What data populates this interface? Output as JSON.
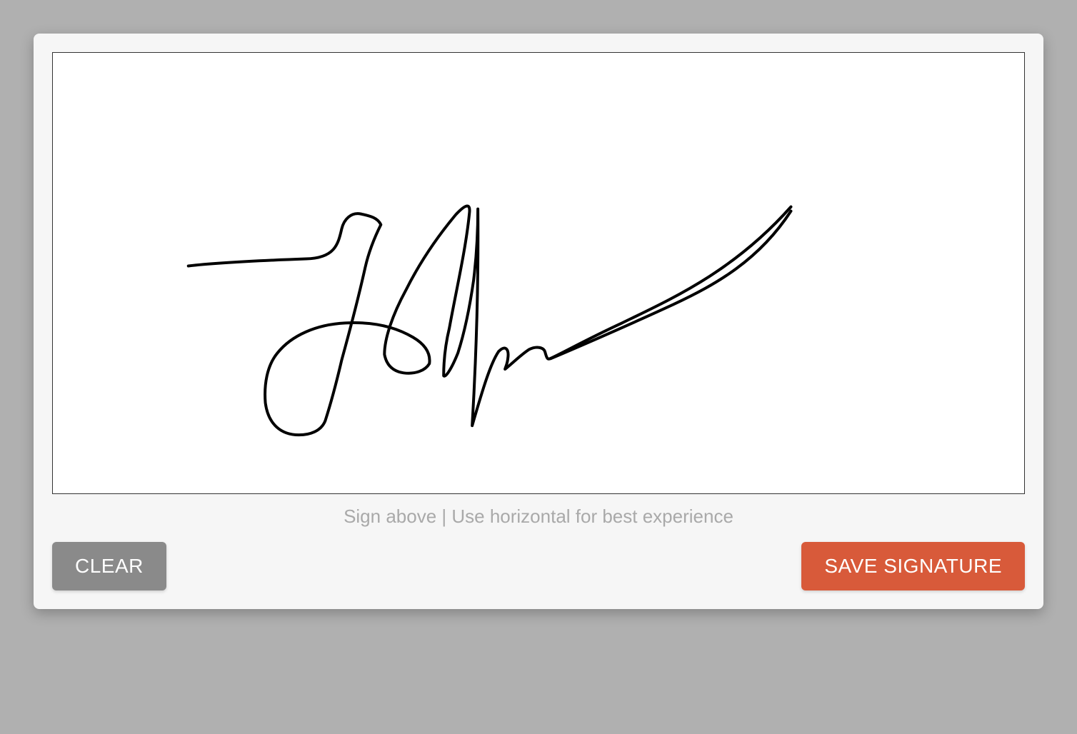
{
  "hint_text": "Sign above | Use horizontal for best experience",
  "buttons": {
    "clear_label": "CLEAR",
    "save_label": "SAVE SIGNATURE"
  },
  "colors": {
    "background": "#b0b0b0",
    "card": "#f6f6f6",
    "canvas": "#ffffff",
    "canvas_border": "#333333",
    "hint_text": "#a9a9a9",
    "clear_button": "#8a8a8a",
    "save_button": "#d85a3a",
    "button_text": "#ffffff",
    "ink": "#000000"
  },
  "signature": {
    "stroke_color": "#000000",
    "stroke_width": 4,
    "paths": [
      "M 190 298 C 232 293 300 290 355 288 C 395 287 400 268 405 246 C 408 233 418 222 432 225 C 445 228 455 230 460 240 C 452 256 443 278 438 300 C 430 336 416 390 405 430 C 398 460 390 490 382 515 C 376 530 360 535 345 535 C 320 535 302 520 298 490 C 296 465 300 438 315 420 C 335 395 370 380 410 378 C 445 376 478 382 505 398 C 522 408 530 420 528 435 C 522 445 508 450 492 448 C 478 446 468 438 465 422 C 465 400 476 367 495 332 C 515 292 540 256 565 226 C 580 210 586 210 584 225 C 579 275 565 335 556 385 C 550 410 548 432 548 452 C 550 455 558 445 568 420 C 576 395 584 360 590 318 C 594 285 596 248 596 218 C 597 323 594 420 588 522 C 603 470 614 434 625 418 C 635 408 640 415 638 428 C 637 438 632 445 635 442 C 645 434 657 422 668 415 C 678 410 688 412 690 418 C 692 425 693 430 697 428 C 715 420 746 402 798 378 C 870 343 955 305 1035 215",
      "M 698 428 C 745 408 805 382 870 352 C 930 324 990 290 1035 221"
    ]
  }
}
